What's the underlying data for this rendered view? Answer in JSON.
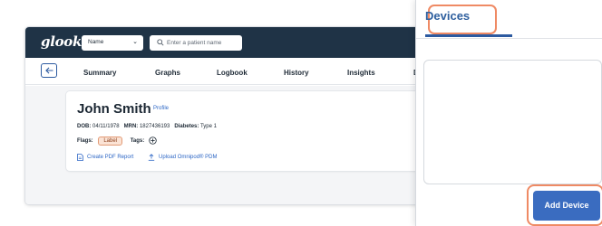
{
  "app": {
    "logo": "glooko",
    "name_select": "Name",
    "search_placeholder": "Enter a patient name"
  },
  "tabs": {
    "summary": "Summary",
    "graphs": "Graphs",
    "logbook": "Logbook",
    "history": "History",
    "insights": "Insights",
    "devices_partial": "D"
  },
  "patient": {
    "name": "John Smith",
    "profile_link": "Profile",
    "dob_label": "DOB:",
    "dob_value": "04/11/1978",
    "mrn_label": "MRN:",
    "mrn_value": "1827436193",
    "diabetes_label": "Diabetes:",
    "diabetes_value": "Type 1",
    "flags_label": "Flags:",
    "flag_badge": "Label",
    "tags_label": "Tags:",
    "create_pdf": "Create PDF Report",
    "upload": "Upload Omnipod® PDM"
  },
  "devices_panel": {
    "tab_label": "Devices",
    "add_button": "Add Device"
  },
  "colors": {
    "topbar": "#1f3346",
    "accent_blue": "#3a6cc0",
    "highlight_orange": "#ef8a64",
    "link_blue": "#2c66c5"
  }
}
